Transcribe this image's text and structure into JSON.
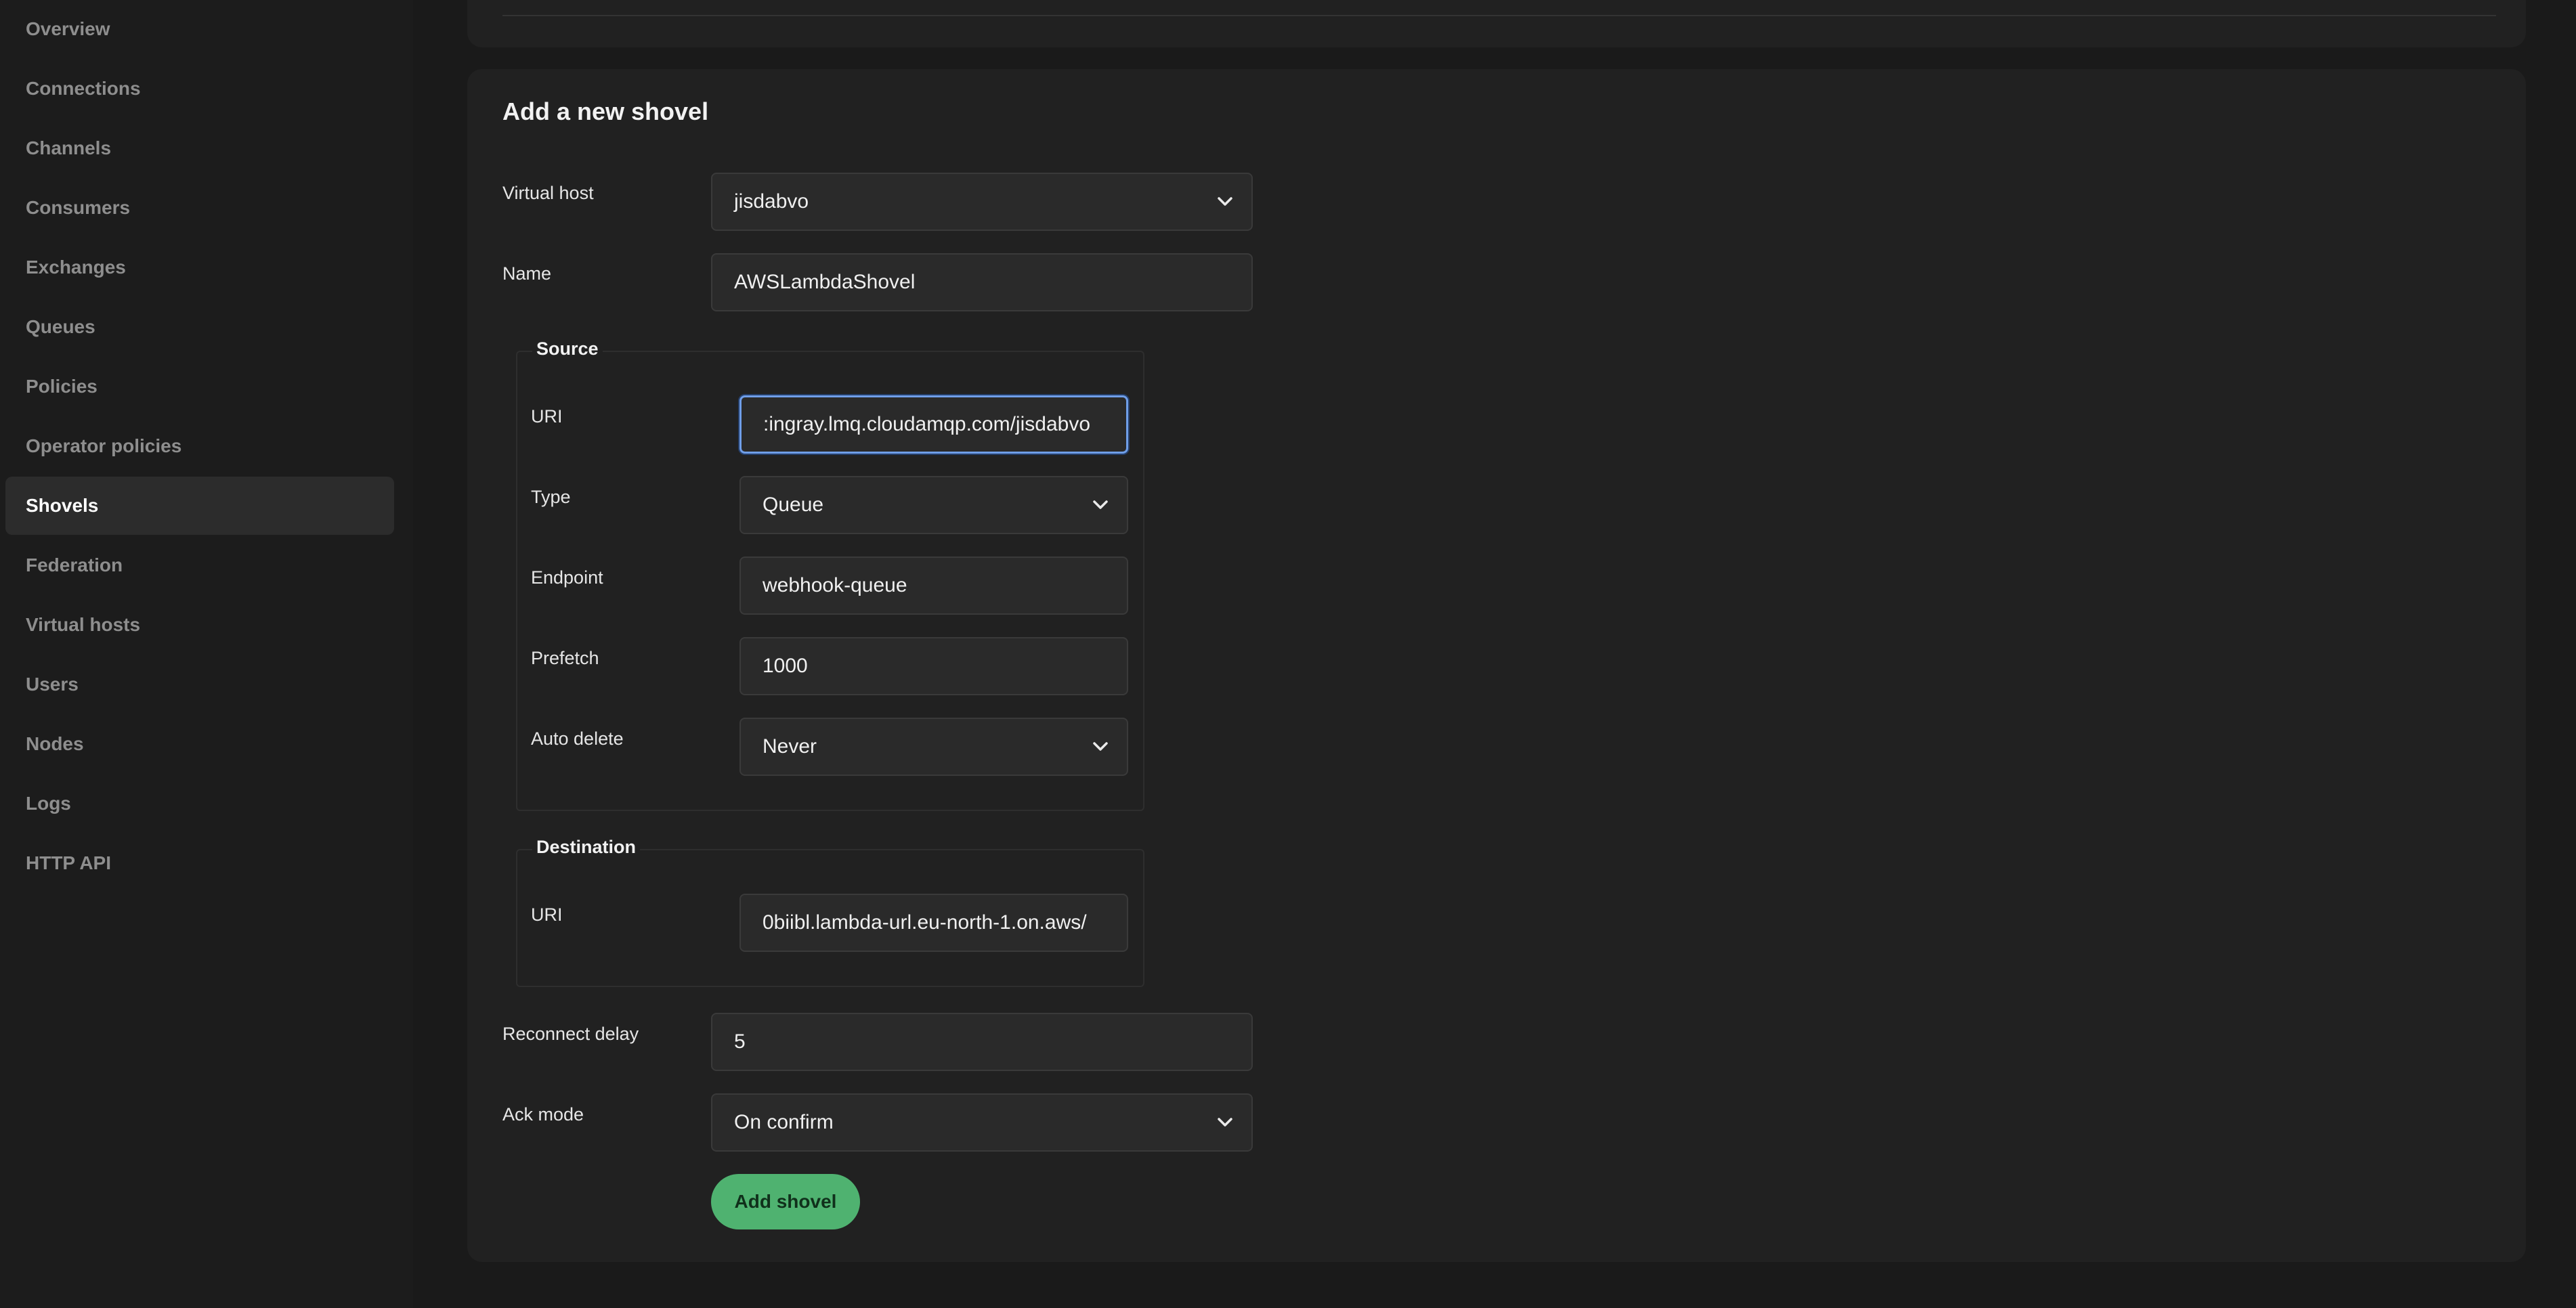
{
  "sidebar": {
    "items": [
      {
        "label": "Overview",
        "active": false
      },
      {
        "label": "Connections",
        "active": false
      },
      {
        "label": "Channels",
        "active": false
      },
      {
        "label": "Consumers",
        "active": false
      },
      {
        "label": "Exchanges",
        "active": false
      },
      {
        "label": "Queues",
        "active": false
      },
      {
        "label": "Policies",
        "active": false
      },
      {
        "label": "Operator policies",
        "active": false
      },
      {
        "label": "Shovels",
        "active": true
      },
      {
        "label": "Federation",
        "active": false
      },
      {
        "label": "Virtual hosts",
        "active": false
      },
      {
        "label": "Users",
        "active": false
      },
      {
        "label": "Nodes",
        "active": false
      },
      {
        "label": "Logs",
        "active": false
      },
      {
        "label": "HTTP API",
        "active": false
      }
    ]
  },
  "form": {
    "title": "Add a new shovel",
    "vhost": {
      "label": "Virtual host",
      "value": "jisdabvo"
    },
    "name": {
      "label": "Name",
      "value": "AWSLambdaShovel"
    },
    "source": {
      "legend": "Source",
      "uri": {
        "label": "URI",
        "value": ":ingray.lmq.cloudamqp.com/jisdabvo"
      },
      "type": {
        "label": "Type",
        "value": "Queue"
      },
      "endpoint": {
        "label": "Endpoint",
        "value": "webhook-queue"
      },
      "prefetch": {
        "label": "Prefetch",
        "value": "1000"
      },
      "auto_delete": {
        "label": "Auto delete",
        "value": "Never"
      }
    },
    "destination": {
      "legend": "Destination",
      "uri": {
        "label": "URI",
        "value": "0biibl.lambda-url.eu-north-1.on.aws/"
      }
    },
    "reconnect_delay": {
      "label": "Reconnect delay",
      "value": "5"
    },
    "ack_mode": {
      "label": "Ack mode",
      "value": "On confirm"
    },
    "submit_label": "Add shovel"
  },
  "colors": {
    "background": "#1a1a1a",
    "card": "#212121",
    "accent": "#4fb270",
    "focus": "#6f9ee8"
  }
}
